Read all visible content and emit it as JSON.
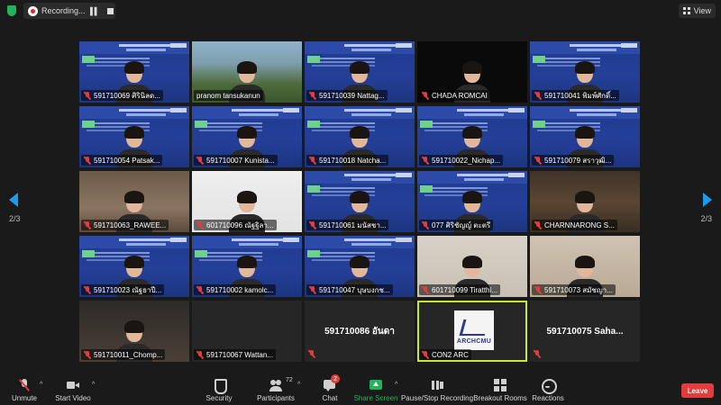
{
  "topbar": {
    "recording_label": "Recording...",
    "view_label": "View"
  },
  "pager": {
    "left_label": "2/3",
    "right_label": "2/3"
  },
  "tiles": [
    {
      "name": "591710069 ศิรินิลด...",
      "bg": "slide",
      "person": true
    },
    {
      "name": "pranom tansukanun",
      "bg": "outdoor",
      "person": true,
      "unmuted": true
    },
    {
      "name": "591710039 Nattag...",
      "bg": "slide",
      "person": true
    },
    {
      "name": "CHADA ROMCAI",
      "bg": "black",
      "person": true
    },
    {
      "name": "591710041 พิมพ์ศักดิ์...",
      "bg": "slide",
      "person": true
    },
    {
      "name": "591710054 Patsak...",
      "bg": "slide",
      "person": true
    },
    {
      "name": "591710007 Kunista...",
      "bg": "slide",
      "person": true
    },
    {
      "name": "591710018 Natcha...",
      "bg": "slide",
      "person": true
    },
    {
      "name": "591710022_Nichap...",
      "bg": "slide",
      "person": true
    },
    {
      "name": "591710079 สราวุฒิ...",
      "bg": "slide",
      "person": true
    },
    {
      "name": "591710063_RAWEE...",
      "bg": "room",
      "person": true
    },
    {
      "name": "601710096 ณัฐฐิลา...",
      "bg": "white",
      "person": true
    },
    {
      "name": "591710061 มนัสชา...",
      "bg": "slide",
      "person": true
    },
    {
      "name": "077 ศิริชัญญ์ ตะตรี",
      "bg": "slide",
      "person": true
    },
    {
      "name": "CHARNNARONG S...",
      "bg": "shelf",
      "person": true
    },
    {
      "name": "591710023 ณัฐธาปี...",
      "bg": "slide",
      "person": true
    },
    {
      "name": "591710002 kamolc...",
      "bg": "slide",
      "person": true
    },
    {
      "name": "591710047 บุษบงกช...",
      "bg": "slide",
      "person": true
    },
    {
      "name": "601710099 Tiratthi...",
      "bg": "wall",
      "person": true
    },
    {
      "name": "591710073 สมัชญา...",
      "bg": "warm",
      "person": true
    },
    {
      "name": "591710011_Chomp...",
      "bg": "dim",
      "person": true
    },
    {
      "name": "591710067 Wattan...",
      "bg": "dark",
      "person": false
    },
    {
      "name": "591710086 อันดา",
      "bg": "dark",
      "person": false,
      "center": true
    },
    {
      "name": "CON2 ARC",
      "bg": "dark",
      "person": false,
      "logo": true,
      "active": true
    },
    {
      "name": "591710075 Saha...",
      "bg": "dark",
      "person": false,
      "center": true
    }
  ],
  "logo": {
    "text": "ARCHCMU"
  },
  "toolbar": {
    "unmute": "Unmute",
    "start_video": "Start Video",
    "security": "Security",
    "participants": "Participants",
    "participants_count": "72",
    "chat": "Chat",
    "chat_badge": "2",
    "share_screen": "Share Screen",
    "record": "Pause/Stop Recording",
    "breakout": "Breakout Rooms",
    "reactions": "Reactions",
    "leave": "Leave"
  },
  "colors": {
    "accent_green": "#23b35b",
    "active_speaker": "#c8e82c",
    "leave_red": "#e23c3c",
    "pager_blue": "#1e9be8"
  }
}
